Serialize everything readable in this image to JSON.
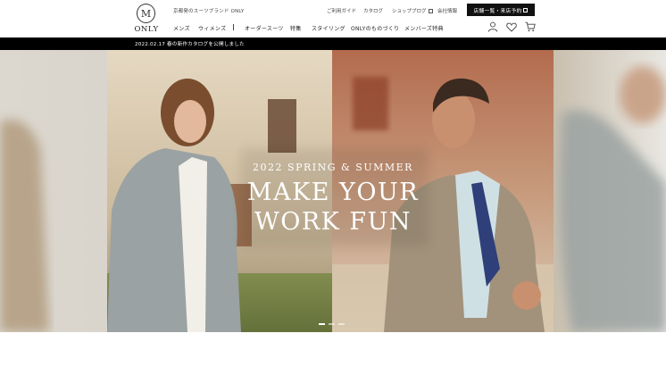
{
  "header": {
    "logo_text": "ONLY",
    "logo_mark": "M",
    "tagline": "京都発のスーツブランド ONLY",
    "utility": {
      "guide": "ご利用ガイド",
      "catalog": "カタログ",
      "blog": "ショップブログ",
      "company": "会社情報"
    },
    "reserve_button": "店舗一覧・来店予約",
    "nav": {
      "mens": "メンズ",
      "womens": "ウィメンズ",
      "separator": "|",
      "order_suit": "オーダースーツ",
      "tokushu": "特集",
      "styling": "スタイリング",
      "monozukuri": "ONLYのものづくり",
      "members": "メンバーズ特典"
    },
    "icons": {
      "user": "user-icon",
      "favorite": "heart-icon",
      "cart": "cart-icon"
    }
  },
  "news": {
    "text": "2022.02.17 春の新作カタログを公開しました"
  },
  "hero": {
    "subtitle": "2022 SPRING & SUMMER",
    "headline_line1": "MAKE YOUR",
    "headline_line2": "WORK FUN",
    "slide_count": 3,
    "active_slide": 1
  },
  "colors": {
    "news_bar": "#000000",
    "button_bg": "#111111",
    "text": "#222222"
  }
}
